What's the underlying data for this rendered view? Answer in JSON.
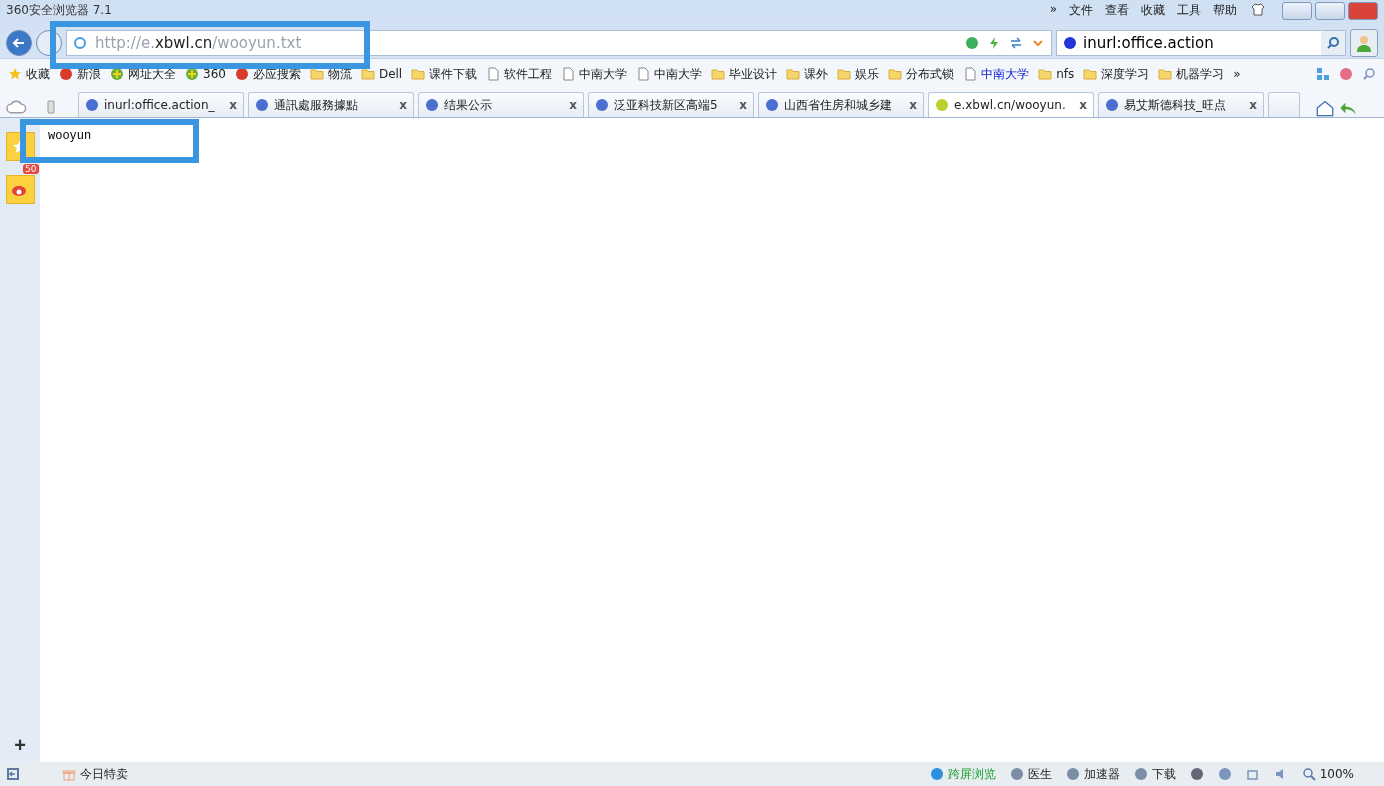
{
  "window": {
    "title": "360安全浏览器 7.1"
  },
  "menu": [
    "»",
    "文件",
    "查看",
    "收藏",
    "工具",
    "帮助"
  ],
  "address": {
    "scheme": "http://e.",
    "host": "xbwl.cn",
    "path": "/wooyun.txt"
  },
  "search": {
    "value": "inurl:office.action"
  },
  "bookmarks": [
    {
      "label": "收藏",
      "kind": "star",
      "highlighted": false
    },
    {
      "label": "新浪",
      "kind": "site",
      "highlighted": false
    },
    {
      "label": "网址大全",
      "kind": "plus",
      "highlighted": false
    },
    {
      "label": "360",
      "kind": "plus",
      "highlighted": false
    },
    {
      "label": "必应搜索",
      "kind": "site",
      "highlighted": false
    },
    {
      "label": "物流",
      "kind": "folder",
      "highlighted": false
    },
    {
      "label": "Dell",
      "kind": "folder",
      "highlighted": false
    },
    {
      "label": "课件下载",
      "kind": "folder",
      "highlighted": false
    },
    {
      "label": "软件工程",
      "kind": "page",
      "highlighted": false
    },
    {
      "label": "中南大学",
      "kind": "page",
      "highlighted": false
    },
    {
      "label": "中南大学",
      "kind": "page",
      "highlighted": false
    },
    {
      "label": "毕业设计",
      "kind": "folder",
      "highlighted": false
    },
    {
      "label": "课外",
      "kind": "folder",
      "highlighted": false
    },
    {
      "label": "娱乐",
      "kind": "folder",
      "highlighted": false
    },
    {
      "label": "分布式锁",
      "kind": "folder",
      "highlighted": false
    },
    {
      "label": "中南大学",
      "kind": "page",
      "highlighted": true
    },
    {
      "label": "nfs",
      "kind": "folder",
      "highlighted": false
    },
    {
      "label": "深度学习",
      "kind": "folder",
      "highlighted": false
    },
    {
      "label": "机器学习",
      "kind": "folder",
      "highlighted": false
    }
  ],
  "bookmarks_more": "»",
  "tabs": [
    {
      "title": "inurl:office.action_",
      "close": "x",
      "selected": false
    },
    {
      "title": "通訊處服務據點",
      "close": "x",
      "selected": false
    },
    {
      "title": "结果公示",
      "close": "x",
      "selected": false
    },
    {
      "title": "泛亚科技新区高端5",
      "close": "x",
      "selected": false
    },
    {
      "title": "山西省住房和城乡建",
      "close": "x",
      "selected": false
    },
    {
      "title": "e.xbwl.cn/wooyun.",
      "close": "x",
      "selected": true
    },
    {
      "title": "易艾斯德科技_旺点",
      "close": "x",
      "selected": false
    }
  ],
  "sidebar": {
    "weibo_badge": "50",
    "add": "+"
  },
  "page_text": "wooyun",
  "status_bar": {
    "left": "今日特卖",
    "items": [
      "跨屏浏览",
      "医生",
      "加速器",
      "下载"
    ],
    "zoom": "100%"
  }
}
